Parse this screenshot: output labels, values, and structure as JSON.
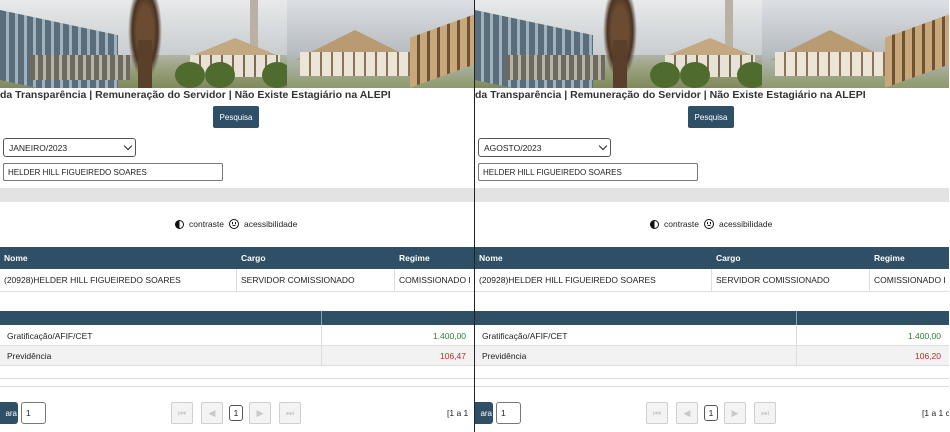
{
  "panels": [
    {
      "title": "da Transparência | Remuneração do Servidor | Não Existe Estagiário na ALEPI",
      "search_button": "Pesquisa",
      "period_select": "JANEIRO/2023",
      "name_field": "HELDER HILL FIGUEIREDO SOARES",
      "accessibility": {
        "contrast": "contraste",
        "accessibility": "acessibilidade"
      },
      "table": {
        "headers": [
          "Nome",
          "Cargo",
          "Regime"
        ],
        "row": [
          "(20928)HELDER HILL FIGUEIREDO SOARES",
          "SERVIDOR COMISSIONADO",
          "COMISSIONADO I"
        ]
      },
      "payments": [
        {
          "label": "Gratificação/AFIF/CET",
          "value": "1.400,00",
          "color": "#2e7d32"
        },
        {
          "label": "Previdência",
          "value": "106,47",
          "color": "#c62828"
        }
      ],
      "pager": {
        "goto_label": "ara",
        "page_input": "1",
        "current_page": "1",
        "range": "[1 a 1"
      }
    },
    {
      "title": "da Transparência | Remuneração do Servidor | Não Existe Estagiário na ALEPI",
      "search_button": "Pesquisa",
      "period_select": "AGOSTO/2023",
      "name_field": "HELDER HILL FIGUEIREDO SOARES",
      "accessibility": {
        "contrast": "contraste",
        "accessibility": "acessibilidade"
      },
      "table": {
        "headers": [
          "Nome",
          "Cargo",
          "Regime"
        ],
        "row": [
          "(20928)HELDER HILL FIGUEIREDO SOARES",
          "SERVIDOR COMISSIONADO",
          "COMISSIONADO I"
        ]
      },
      "payments": [
        {
          "label": "Gratificação/AFIF/CET",
          "value": "1.400,00",
          "color": "#2e7d32"
        },
        {
          "label": "Previdência",
          "value": "106,20",
          "color": "#c62828"
        }
      ],
      "pager": {
        "goto_label": "ara",
        "page_input": "1",
        "current_page": "1",
        "range": "[1 a 1 c"
      }
    }
  ],
  "theme": {
    "primary": "#2f4f66"
  }
}
